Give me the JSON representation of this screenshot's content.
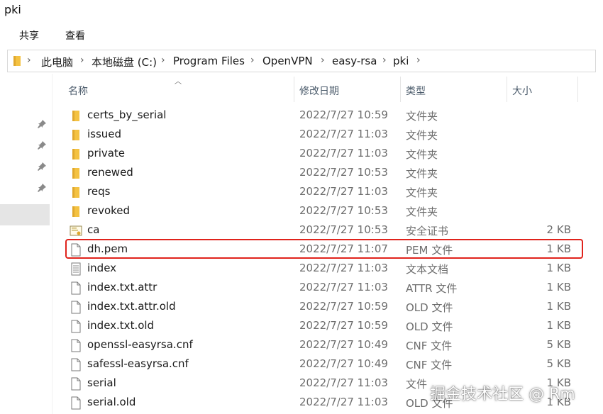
{
  "window": {
    "title": "pki"
  },
  "ribbon": {
    "tabs": [
      "共享",
      "查看"
    ]
  },
  "address": {
    "crumbs": [
      "此电脑",
      "本地磁盘 (C:)",
      "Program Files",
      "OpenVPN",
      "easy-rsa",
      "pki"
    ]
  },
  "columns": {
    "name": "名称",
    "date": "修改日期",
    "type": "类型",
    "size": "大小"
  },
  "files": [
    {
      "name": "certs_by_serial",
      "date": "2022/7/27 10:59",
      "type": "文件夹",
      "size": "",
      "icon": "folder-icon"
    },
    {
      "name": "issued",
      "date": "2022/7/27 11:03",
      "type": "文件夹",
      "size": "",
      "icon": "folder-icon"
    },
    {
      "name": "private",
      "date": "2022/7/27 11:03",
      "type": "文件夹",
      "size": "",
      "icon": "folder-icon"
    },
    {
      "name": "renewed",
      "date": "2022/7/27 10:53",
      "type": "文件夹",
      "size": "",
      "icon": "folder-icon"
    },
    {
      "name": "reqs",
      "date": "2022/7/27 11:03",
      "type": "文件夹",
      "size": "",
      "icon": "folder-icon"
    },
    {
      "name": "revoked",
      "date": "2022/7/27 10:53",
      "type": "文件夹",
      "size": "",
      "icon": "folder-icon"
    },
    {
      "name": "ca",
      "date": "2022/7/27 10:53",
      "type": "安全证书",
      "size": "2 KB",
      "icon": "certificate-icon"
    },
    {
      "name": "dh.pem",
      "date": "2022/7/27 11:07",
      "type": "PEM 文件",
      "size": "1 KB",
      "icon": "file-icon"
    },
    {
      "name": "index",
      "date": "2022/7/27 11:03",
      "type": "文本文档",
      "size": "1 KB",
      "icon": "text-file-icon"
    },
    {
      "name": "index.txt.attr",
      "date": "2022/7/27 11:03",
      "type": "ATTR 文件",
      "size": "1 KB",
      "icon": "file-icon"
    },
    {
      "name": "index.txt.attr.old",
      "date": "2022/7/27 10:59",
      "type": "OLD 文件",
      "size": "1 KB",
      "icon": "file-icon"
    },
    {
      "name": "index.txt.old",
      "date": "2022/7/27 10:59",
      "type": "OLD 文件",
      "size": "1 KB",
      "icon": "file-icon"
    },
    {
      "name": "openssl-easyrsa.cnf",
      "date": "2022/7/27 10:49",
      "type": "CNF 文件",
      "size": "5 KB",
      "icon": "file-icon"
    },
    {
      "name": "safessl-easyrsa.cnf",
      "date": "2022/7/27 10:49",
      "type": "CNF 文件",
      "size": "5 KB",
      "icon": "file-icon"
    },
    {
      "name": "serial",
      "date": "2022/7/27 11:03",
      "type": "文件",
      "size": "1 KB",
      "icon": "file-icon"
    },
    {
      "name": "serial.old",
      "date": "2022/7/27 11:03",
      "type": "OLD 文件",
      "size": "1 KB",
      "icon": "file-icon"
    }
  ],
  "watermark": "掘金技术社区 @ Rm",
  "colors": {
    "highlight": "#e0231c",
    "folder": "#f4c242",
    "selected_nav": "#e5e5e5"
  }
}
